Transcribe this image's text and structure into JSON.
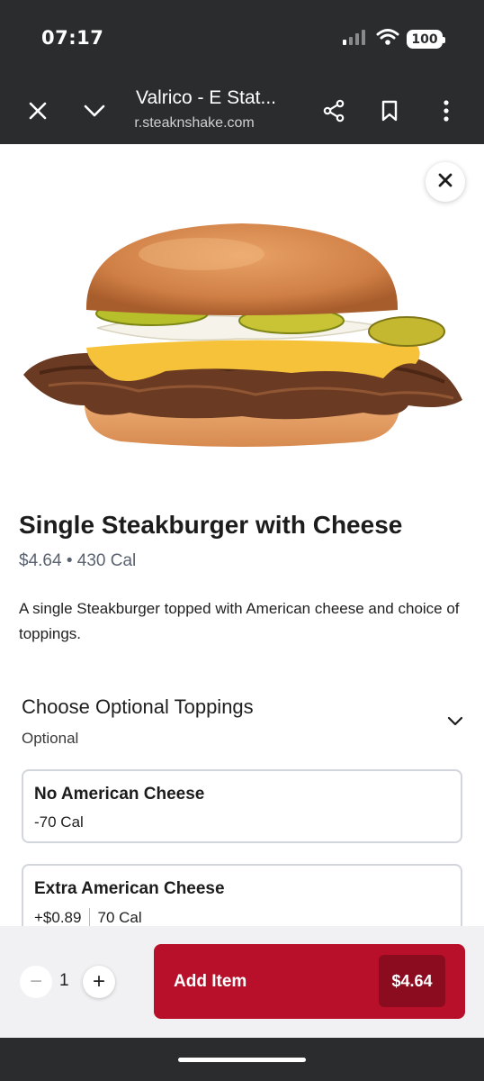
{
  "status_bar": {
    "time": "07:17",
    "battery": "100",
    "icons": [
      "signal-icon",
      "wifi-icon",
      "battery-icon"
    ]
  },
  "browser": {
    "title": "Valrico - E Stat...",
    "url": " r.steaknshake.com",
    "icons": [
      "close-icon",
      "chevron-down-icon",
      "share-icon",
      "bookmark-icon",
      "more-icon"
    ]
  },
  "item": {
    "name": "Single Steakburger with Cheese",
    "price": "$4.64",
    "separator": "•",
    "calories": "430 Cal",
    "description": "A single Steakburger topped with American cheese and choice of toppings."
  },
  "toppings": {
    "title": "Choose Optional Toppings",
    "subtitle": "Optional",
    "options": [
      {
        "name": "No American Cheese",
        "price": "",
        "calories": "-70 Cal"
      },
      {
        "name": "Extra American Cheese",
        "price": "+$0.89",
        "calories": "70 Cal"
      }
    ]
  },
  "order": {
    "quantity": "1",
    "minus": "−",
    "plus": "+",
    "add_label": "Add Item",
    "add_price": "$4.64"
  },
  "colors": {
    "chrome": "#2b2c2e",
    "accent": "#b8102a",
    "accent_dark": "#8b0c1f"
  }
}
